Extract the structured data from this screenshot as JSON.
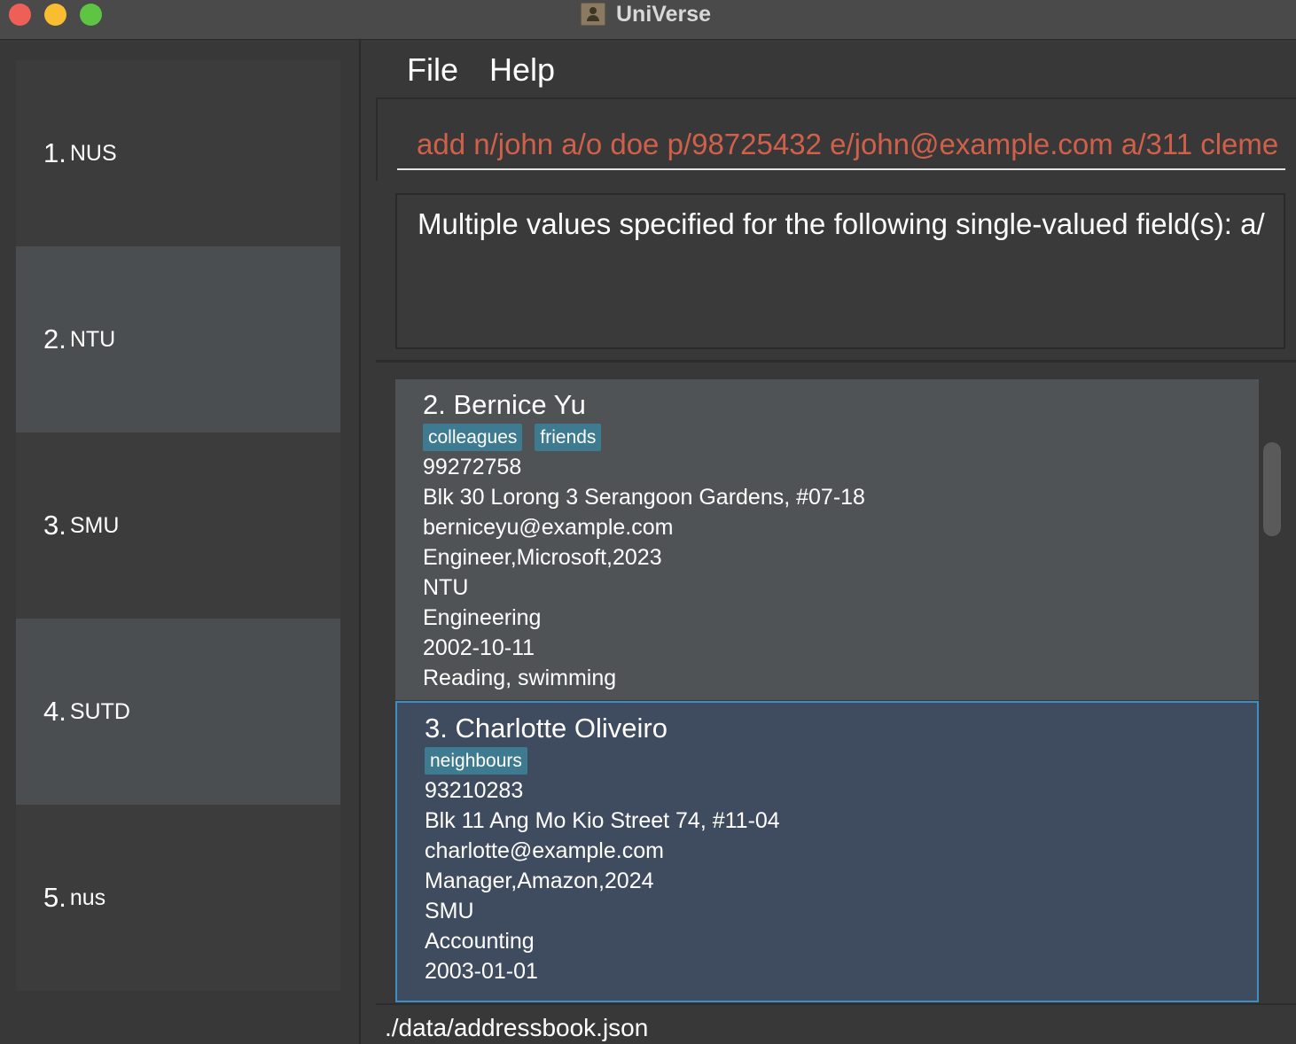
{
  "window": {
    "title": "UniVerse"
  },
  "universities": [
    {
      "number": "1.",
      "name": "NUS"
    },
    {
      "number": "2.",
      "name": "NTU"
    },
    {
      "number": "3.",
      "name": "SMU"
    },
    {
      "number": "4.",
      "name": "SUTD"
    },
    {
      "number": "5.",
      "name": "nus"
    }
  ],
  "menu": {
    "file": "File",
    "help": "Help"
  },
  "command": {
    "value": "add n/john a/o doe p/98725432 e/john@example.com a/311 cleme"
  },
  "result": {
    "message": "Multiple values specified for the following single-valued field(s): a/"
  },
  "persons": [
    {
      "name": "2. Bernice Yu",
      "tags": [
        "colleagues",
        "friends"
      ],
      "phone": "99272758",
      "address": "Blk 30 Lorong 3 Serangoon Gardens, #07-18",
      "email": "berniceyu@example.com",
      "job": "Engineer,Microsoft,2023",
      "university": "NTU",
      "major": "Engineering",
      "birthday": "2002-10-11",
      "interests": "Reading, swimming"
    },
    {
      "name": "3. Charlotte Oliveiro",
      "tags": [
        "neighbours"
      ],
      "phone": "93210283",
      "address": "Blk 11 Ang Mo Kio Street 74, #11-04",
      "email": "charlotte@example.com",
      "job": "Manager,Amazon,2024",
      "university": "SMU",
      "major": "Accounting",
      "birthday": "2003-01-01"
    }
  ],
  "status": {
    "path": "./data/addressbook.json"
  },
  "colors": {
    "command_error": "#d0604a",
    "tag": "#3e7b91",
    "selected_card": "#3f4b5f",
    "selected_border": "#3d8ec2"
  }
}
